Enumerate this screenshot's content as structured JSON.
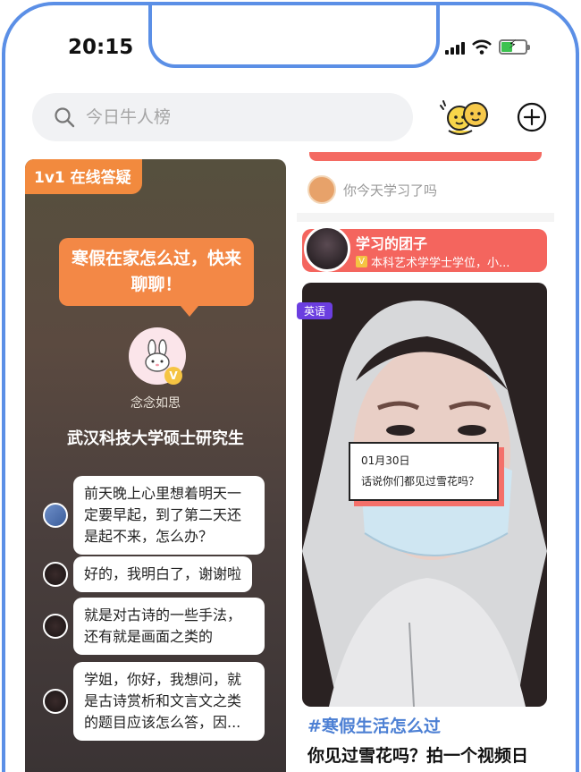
{
  "status_bar": {
    "time": "20:15",
    "battery_level": 0.45,
    "icons": [
      "signal-icon",
      "wifi-icon",
      "battery-charging-icon"
    ]
  },
  "search": {
    "placeholder": "今日牛人榜"
  },
  "header_icons": [
    "friends-icon",
    "add-circle-icon"
  ],
  "live_card": {
    "tag": "1v1 在线答疑",
    "topic": "寒假在家怎么过，快来聊聊！",
    "host_name": "念念如思",
    "host_title": "武汉科技大学硕士研究生",
    "messages": [
      {
        "text": "前天晚上心里想着明天一定要早起，到了第二天还是起不来，怎么办？"
      },
      {
        "text": "好的，我明白了，谢谢啦"
      },
      {
        "text": "就是对古诗的一些手法，还有就是画面之类的"
      },
      {
        "text": "学姐，你好，我想问，就是古诗赏析和文言文之类的题目应该怎么答，因..."
      }
    ],
    "colors": {
      "tag": "#f28a3e",
      "bubble": "#f38846"
    }
  },
  "right_column": {
    "study_prompt": "你今天学习了吗",
    "profile": {
      "name": "学习的团子",
      "description": "本科艺术学学士学位，小..."
    },
    "post": {
      "language_tag": "英语",
      "date": "01月30日",
      "question": "话说你们都见过雪花吗？",
      "hashtag": "#寒假生活怎么过",
      "title": "你见过雪花吗？拍一个视频日"
    },
    "colors": {
      "accent": "#f4655e",
      "hashtag": "#4d80d4",
      "tag": "#6b3ee0"
    }
  }
}
